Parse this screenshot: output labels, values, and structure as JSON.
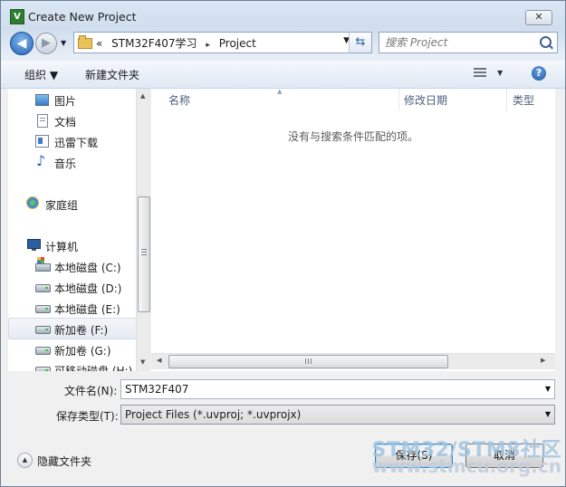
{
  "window": {
    "title": "Create New Project",
    "icon_text": "V"
  },
  "close_glyph": "✕",
  "nav": {
    "back_glyph": "◀",
    "forward_glyph": "▶"
  },
  "address": {
    "overflow": "«",
    "segments": [
      "STM32F407学习",
      "Project"
    ],
    "separator": "▸"
  },
  "search": {
    "placeholder": "搜索 Project"
  },
  "toolbar": {
    "organize": "组织 ▼",
    "new_folder": "新建文件夹",
    "help": "?"
  },
  "sidebar": {
    "items": [
      {
        "label": "图片",
        "icon": "pictures-icon"
      },
      {
        "label": "文档",
        "icon": "documents-icon"
      },
      {
        "label": "迅雷下载",
        "icon": "download-folder-icon"
      },
      {
        "label": "音乐",
        "icon": "music-icon"
      },
      {
        "label": "家庭组",
        "icon": "homegroup-icon"
      },
      {
        "label": "计算机",
        "icon": "computer-icon"
      },
      {
        "label": "本地磁盘 (C:)",
        "icon": "system-drive-icon"
      },
      {
        "label": "本地磁盘 (D:)",
        "icon": "drive-icon"
      },
      {
        "label": "本地磁盘 (E:)",
        "icon": "drive-icon"
      },
      {
        "label": "新加卷 (F:)",
        "icon": "drive-icon",
        "selected": true
      },
      {
        "label": "新加卷 (G:)",
        "icon": "drive-icon"
      },
      {
        "label": "可移动磁盘 (H:)",
        "icon": "removable-drive-icon"
      }
    ]
  },
  "columns": [
    "名称",
    "修改日期",
    "类型"
  ],
  "empty_message": "没有与搜索条件匹配的项。",
  "form": {
    "filename_label": "文件名(N):",
    "filename_value": "STM32F407",
    "filetype_label": "保存类型(T):",
    "filetype_value": "Project Files (*.uvproj; *.uvprojx)"
  },
  "footer": {
    "hide_folders": "隐藏文件夹",
    "save": "保存(S)",
    "cancel": "取消"
  },
  "watermark": {
    "line1": "STM32/STM8社区",
    "line2": "www.stmcu.org.cn"
  }
}
